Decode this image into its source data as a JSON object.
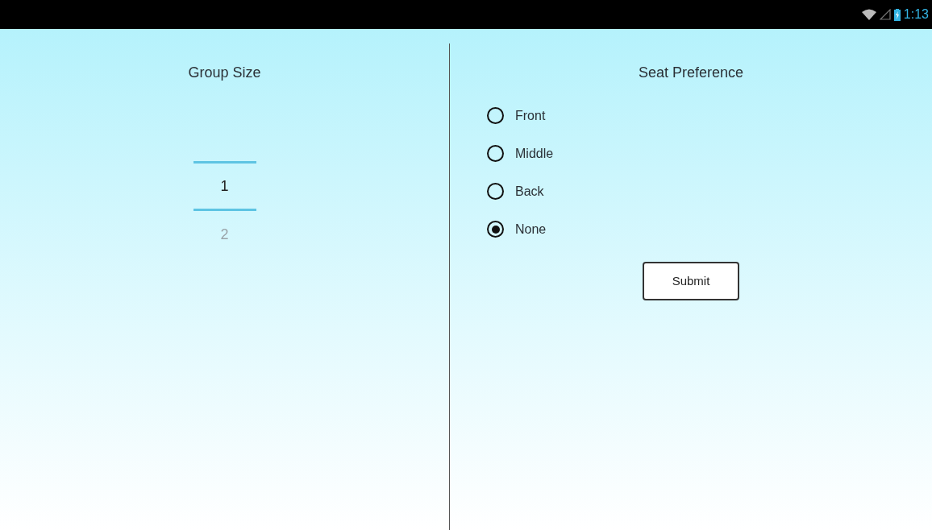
{
  "status_bar": {
    "time": "1:13"
  },
  "group_size": {
    "title": "Group Size",
    "picker": [
      {
        "value": "1",
        "selected": true
      },
      {
        "value": "2",
        "selected": false
      }
    ]
  },
  "seat_preference": {
    "title": "Seat Preference",
    "options": [
      {
        "label": "Front",
        "selected": false
      },
      {
        "label": "Middle",
        "selected": false
      },
      {
        "label": "Back",
        "selected": false
      },
      {
        "label": "None",
        "selected": true
      }
    ],
    "button": "Submit"
  }
}
